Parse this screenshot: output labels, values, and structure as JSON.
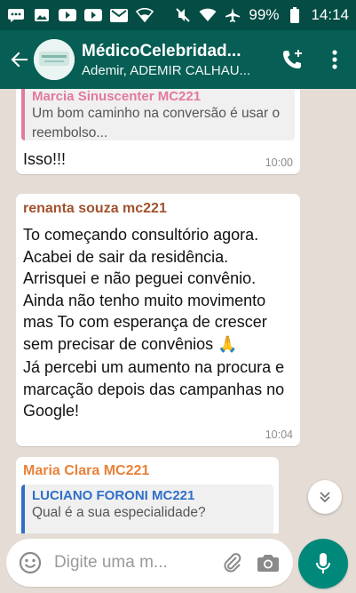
{
  "status_bar": {
    "battery": "99%",
    "time": "14:14"
  },
  "header": {
    "title": "MédicoCelebridad...",
    "subtitle": "Ademir, ADEMIR CALHAU..."
  },
  "messages": [
    {
      "quote_author": "Marcia Sinuscenter MC221",
      "quote_text": "Um bom caminho na conversão é usar o reembolso...",
      "text": "Isso!!!",
      "time": "10:00"
    },
    {
      "author": "renanta souza mc221",
      "author_color": "#a0522d",
      "text": "To começando consultório agora. Acabei de sair da residência. Arrisquei e não peguei convênio. Ainda não tenho muito movimento mas To com esperança de crescer sem precisar de convênios 🙏",
      "text2": "Já percebi um aumento na procura e marcação depois das campanhas no Google!",
      "time": "10:04"
    },
    {
      "author": "Maria Clara MC221",
      "author_color": "#e8823a",
      "quote_author": "LUCIANO FORONI MC221",
      "quote_author_color": "#2f6fc9",
      "quote_text": "Qual é a sua especialidade?"
    }
  ],
  "input": {
    "placeholder": "Digite uma m..."
  },
  "colors": {
    "header_bg": "#075e54",
    "status_bg": "#054d44",
    "chat_bg": "#e5ddd5",
    "accent": "#00897b"
  }
}
